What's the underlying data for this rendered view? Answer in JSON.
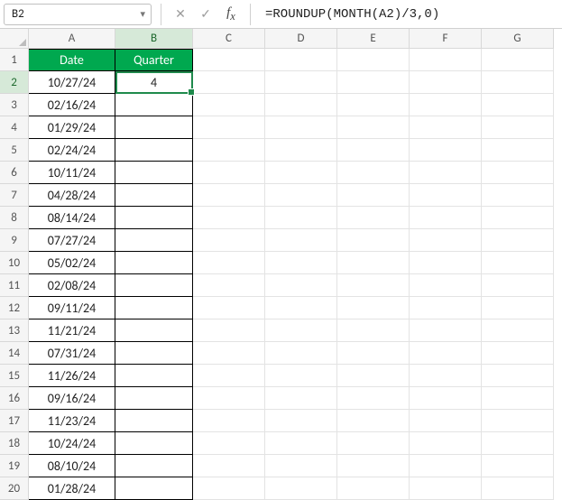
{
  "nameBox": "B2",
  "formula": "=ROUNDUP(MONTH(A2)/3,0)",
  "columns": [
    "A",
    "B",
    "C",
    "D",
    "E",
    "F",
    "G"
  ],
  "colWidths": {
    "A": 96,
    "B": 86,
    "other": 80
  },
  "selectedCell": "B2",
  "headers": {
    "A": "Date",
    "B": "Quarter"
  },
  "rows": [
    {
      "n": 1
    },
    {
      "n": 2,
      "A": "10/27/24",
      "B": "4"
    },
    {
      "n": 3,
      "A": "02/16/24"
    },
    {
      "n": 4,
      "A": "01/29/24"
    },
    {
      "n": 5,
      "A": "02/24/24"
    },
    {
      "n": 6,
      "A": "10/11/24"
    },
    {
      "n": 7,
      "A": "04/28/24"
    },
    {
      "n": 8,
      "A": "08/14/24"
    },
    {
      "n": 9,
      "A": "07/27/24"
    },
    {
      "n": 10,
      "A": "05/02/24"
    },
    {
      "n": 11,
      "A": "02/08/24"
    },
    {
      "n": 12,
      "A": "09/11/24"
    },
    {
      "n": 13,
      "A": "11/21/24"
    },
    {
      "n": 14,
      "A": "07/31/24"
    },
    {
      "n": 15,
      "A": "11/26/24"
    },
    {
      "n": 16,
      "A": "09/16/24"
    },
    {
      "n": 17,
      "A": "11/23/24"
    },
    {
      "n": 18,
      "A": "10/24/24"
    },
    {
      "n": 19,
      "A": "08/10/24"
    },
    {
      "n": 20,
      "A": "01/28/24"
    }
  ],
  "chart_data": {
    "type": "table",
    "title": "",
    "columns": [
      "Date",
      "Quarter"
    ],
    "data": [
      [
        "10/27/24",
        4
      ],
      [
        "02/16/24",
        null
      ],
      [
        "01/29/24",
        null
      ],
      [
        "02/24/24",
        null
      ],
      [
        "10/11/24",
        null
      ],
      [
        "04/28/24",
        null
      ],
      [
        "08/14/24",
        null
      ],
      [
        "07/27/24",
        null
      ],
      [
        "05/02/24",
        null
      ],
      [
        "02/08/24",
        null
      ],
      [
        "09/11/24",
        null
      ],
      [
        "11/21/24",
        null
      ],
      [
        "07/31/24",
        null
      ],
      [
        "11/26/24",
        null
      ],
      [
        "09/16/24",
        null
      ],
      [
        "11/23/24",
        null
      ],
      [
        "10/24/24",
        null
      ],
      [
        "08/10/24",
        null
      ],
      [
        "01/28/24",
        null
      ]
    ]
  }
}
